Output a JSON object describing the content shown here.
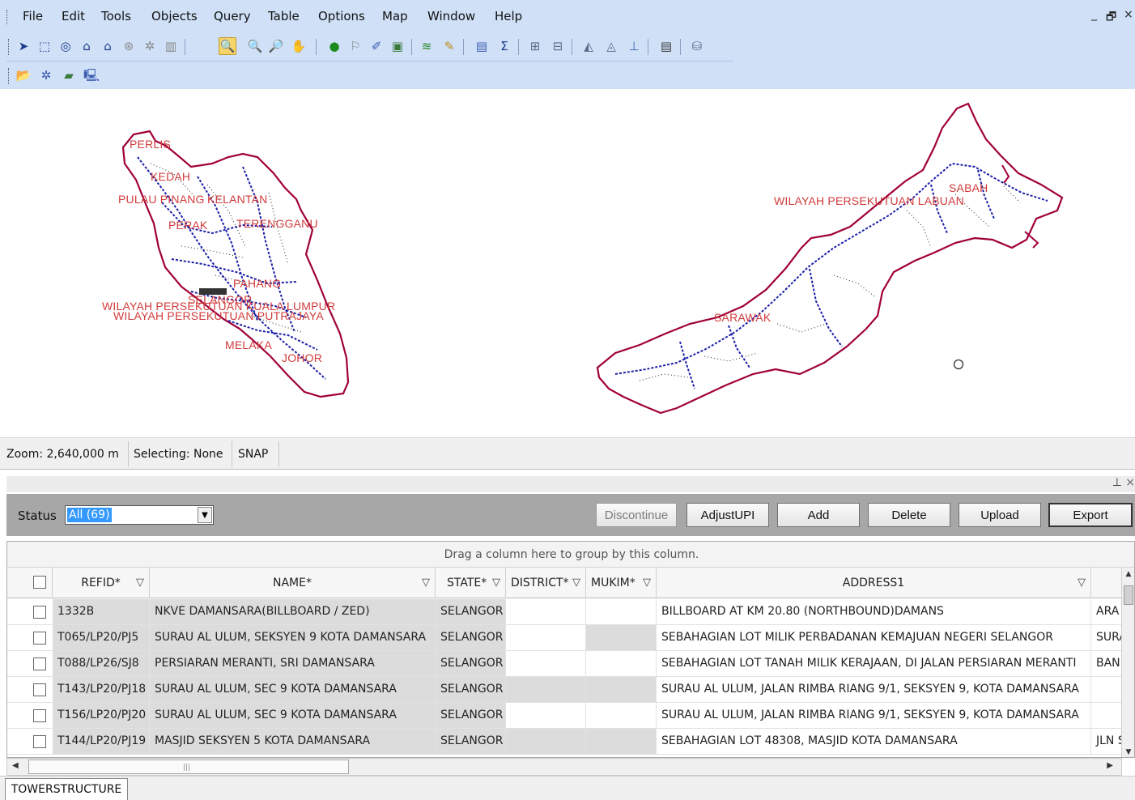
{
  "menu": [
    "File",
    "Edit",
    "Tools",
    "Objects",
    "Query",
    "Table",
    "Options",
    "Map",
    "Window",
    "Help"
  ],
  "window_controls": {
    "minimize": "_",
    "restore": "🗗",
    "close": "×"
  },
  "map": {
    "labels": [
      "PERLIS",
      "KEDAH",
      "PULAU PINANG",
      "KELANTAN",
      "PERAK",
      "TERENGGANU",
      "PAHANG",
      "SELANGOR",
      "WILAYAH PERSEKUTUAN KUALA LUMPUR",
      "WILAYAH PERSEKUTUAN PUTRAJAYA",
      "MELAKA",
      "JOHOR",
      "WILAYAH PERSEKUTUAN LABUAN",
      "SABAH",
      "SARAWAK"
    ],
    "colors": {
      "border": "#a0003a",
      "road": "#1b1ea8",
      "label": "#d13b3b"
    }
  },
  "statusbar": {
    "zoom": "Zoom: 2,640,000 m",
    "selecting": "Selecting: None",
    "snap": "SNAP"
  },
  "dock": {
    "pin": "⊥",
    "close": "×"
  },
  "panel": {
    "status_label": "Status",
    "status_value": "All (69)",
    "buttons": {
      "discontinue": "Discontinue",
      "adjustupi": "AdjustUPI",
      "add": "Add",
      "delete": "Delete",
      "upload": "Upload",
      "export": "Export"
    }
  },
  "grid": {
    "group_hint": "Drag a column here to group by this column.",
    "columns": [
      "REFID*",
      "NAME*",
      "STATE*",
      "DISTRICT*",
      "MUKIM*",
      "ADDRESS1"
    ],
    "rows": [
      {
        "refid": "1332B",
        "name": "NKVE DAMANSARA(BILLBOARD / ZED)",
        "state": "SELANGOR",
        "district": "",
        "mukim": "",
        "address1": "BILLBOARD AT KM 20.80 (NORTHBOUND)DAMANS",
        "extra": "ARA"
      },
      {
        "refid": "T065/LP20/PJ5",
        "name": "SURAU AL ULUM, SEKSYEN 9 KOTA DAMANSARA",
        "state": "SELANGOR",
        "district": "",
        "mukim": "",
        "address1": "SEBAHAGIAN LOT MILIK PERBADANAN KEMAJUAN NEGERI SELANGOR",
        "extra": "SURA"
      },
      {
        "refid": "T088/LP26/SJ8",
        "name": "PERSIARAN MERANTI, SRI DAMANSARA",
        "state": "SELANGOR",
        "district": "",
        "mukim": "",
        "address1": "SEBAHAGIAN LOT TANAH MILIK KERAJAAN, DI JALAN PERSIARAN MERANTI",
        "extra": "BANI"
      },
      {
        "refid": "T143/LP20/PJ18",
        "name": "SURAU AL ULUM, SEC 9 KOTA DAMANSARA",
        "state": "SELANGOR",
        "district": "",
        "mukim": "",
        "address1": "SURAU AL ULUM, JALAN RIMBA RIANG 9/1, SEKSYEN 9, KOTA DAMANSARA",
        "extra": ""
      },
      {
        "refid": "T156/LP20/PJ20",
        "name": "SURAU AL ULUM, SEC 9 KOTA DAMANSARA",
        "state": "SELANGOR",
        "district": "",
        "mukim": "",
        "address1": "SURAU AL ULUM, JALAN RIMBA RIANG 9/1, SEKSYEN 9, KOTA DAMANSARA",
        "extra": ""
      },
      {
        "refid": "T144/LP20/PJ19",
        "name": "MASJID SEKSYEN 5 KOTA DAMANSARA",
        "state": "SELANGOR",
        "district": "",
        "mukim": "",
        "address1": "SEBAHAGIAN LOT 48308, MASJID KOTA DAMANSARA",
        "extra": "JLN S"
      }
    ]
  },
  "tab": "TOWERSTRUCTURE"
}
